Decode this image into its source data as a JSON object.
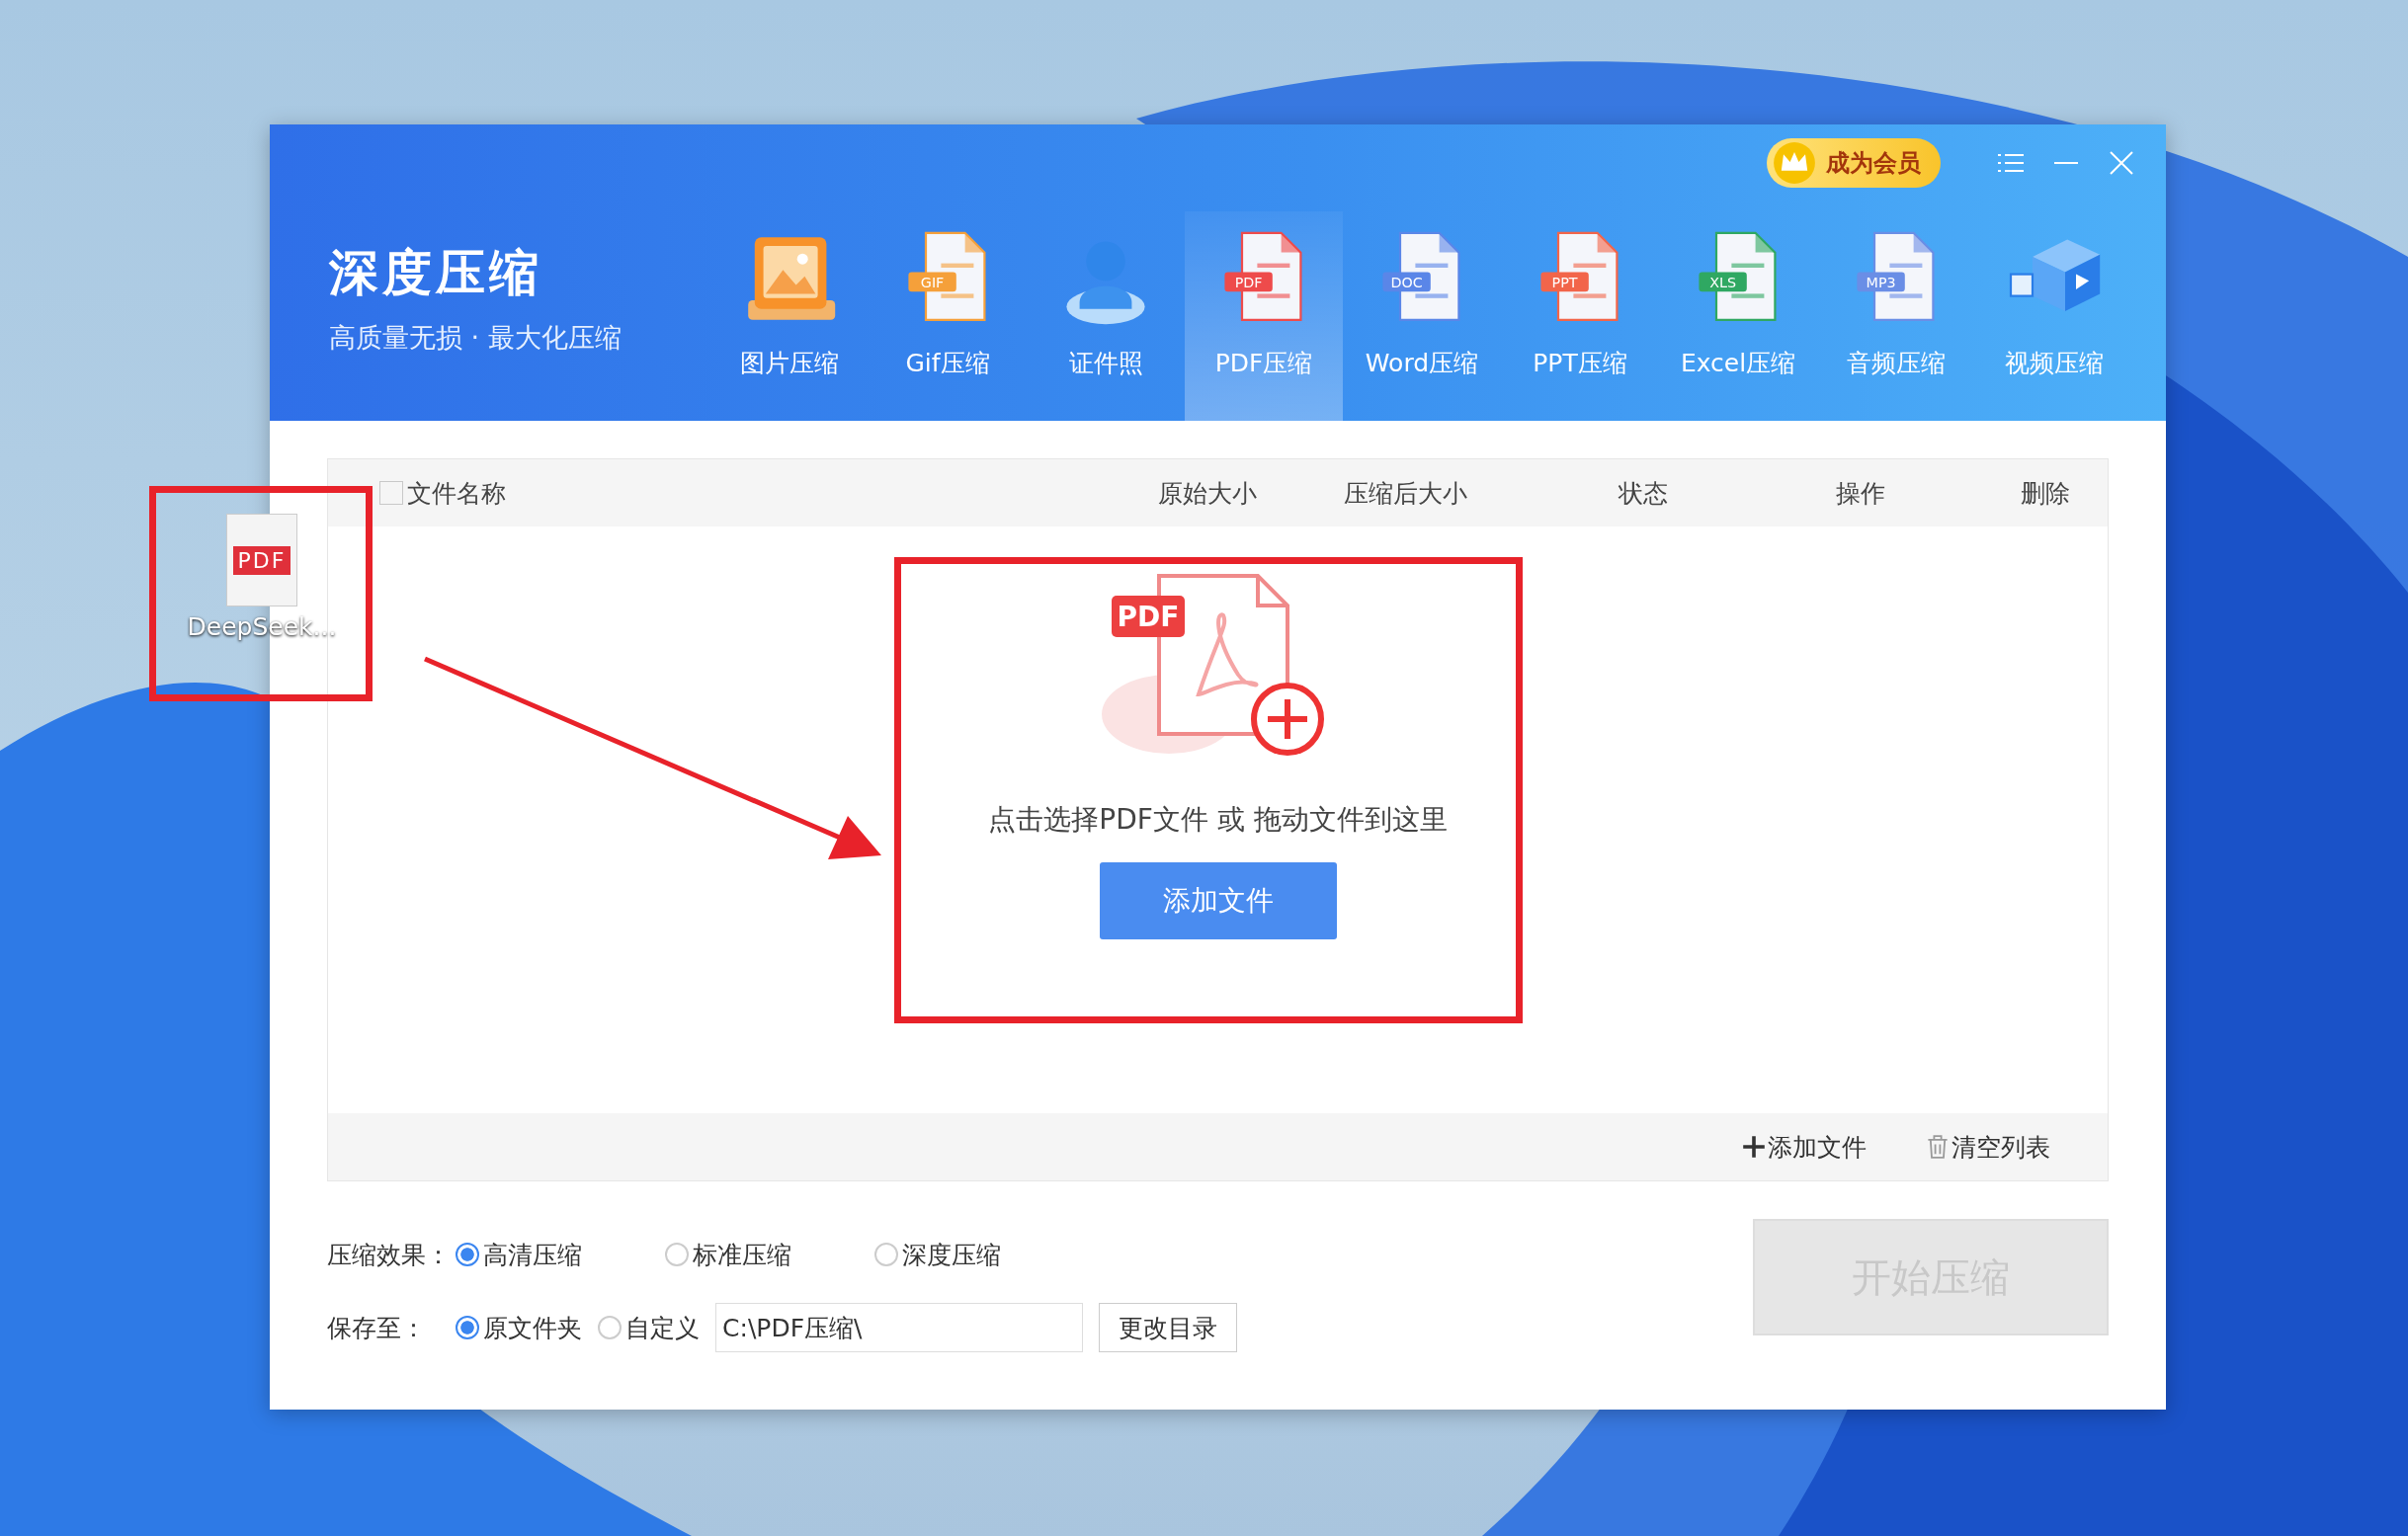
{
  "window": {
    "app_title": "深度压缩",
    "tagline": "高质量无损 · 最大化压缩",
    "member_button": "成为会员"
  },
  "tabs": [
    {
      "label": "图片压缩",
      "kind": "image",
      "selected": false
    },
    {
      "label": "Gif压缩",
      "kind": "doc",
      "icon_text": "GIF",
      "color": "#f5a03a",
      "selected": false
    },
    {
      "label": "证件照",
      "kind": "person",
      "selected": false
    },
    {
      "label": "PDF压缩",
      "kind": "doc",
      "icon_text": "PDF",
      "color": "#ee4b4b",
      "selected": true
    },
    {
      "label": "Word压缩",
      "kind": "doc",
      "icon_text": "DOC",
      "color": "#5a86e8",
      "selected": false
    },
    {
      "label": "PPT压缩",
      "kind": "doc",
      "icon_text": "PPT",
      "color": "#f2654a",
      "selected": false
    },
    {
      "label": "Excel压缩",
      "kind": "doc",
      "icon_text": "XLS",
      "color": "#2fa862",
      "selected": false
    },
    {
      "label": "音频压缩",
      "kind": "doc",
      "icon_text": "MP3",
      "color": "#6a8ee6",
      "selected": false
    },
    {
      "label": "视频压缩",
      "kind": "video",
      "selected": false
    }
  ],
  "table": {
    "select_all_checked": false,
    "columns": [
      "文件名称",
      "原始大小",
      "压缩后大小",
      "状态",
      "操作",
      "删除"
    ]
  },
  "drop_zone": {
    "badge": "PDF",
    "hint": "点击选择PDF文件 或 拖动文件到这里",
    "button": "添加文件"
  },
  "list_actions": [
    {
      "label": "添加文件",
      "kind": "add"
    },
    {
      "label": "清空列表",
      "kind": "clear"
    }
  ],
  "compression": {
    "label": "压缩效果：",
    "options": [
      {
        "label": "高清压缩",
        "selected": true
      },
      {
        "label": "标准压缩",
        "selected": false
      },
      {
        "label": "深度压缩",
        "selected": false
      }
    ]
  },
  "save_to": {
    "label": "保存至：",
    "options": [
      {
        "label": "原文件夹",
        "selected": true
      },
      {
        "label": "自定义",
        "selected": false
      }
    ],
    "path": "C:\\PDF压缩\\",
    "change_button": "更改目录"
  },
  "start_button": {
    "label": "开始压缩",
    "disabled": true
  },
  "desktop_icon": {
    "badge": "PDF",
    "label": "DeepSeek..."
  }
}
